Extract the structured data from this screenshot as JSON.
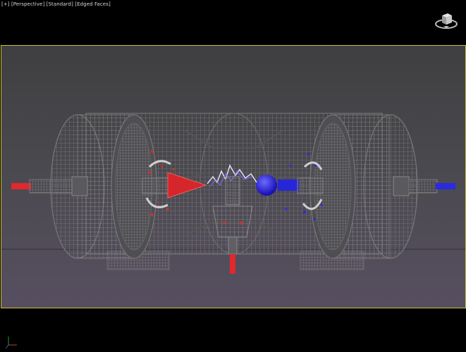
{
  "viewport_label": {
    "plus": "[+]",
    "view": "[Perspective]",
    "shading": "[Standard]",
    "display": "[Edged Faces]"
  },
  "icons": {
    "viewcube": "viewcube-icon",
    "axis": "axis-tripod-icon"
  },
  "colors": {
    "viewport_border": "#c9c23a",
    "positive_charge": "#e0282d",
    "negative_charge": "#2a2ae0",
    "wireframe": "#9a9a9a"
  }
}
